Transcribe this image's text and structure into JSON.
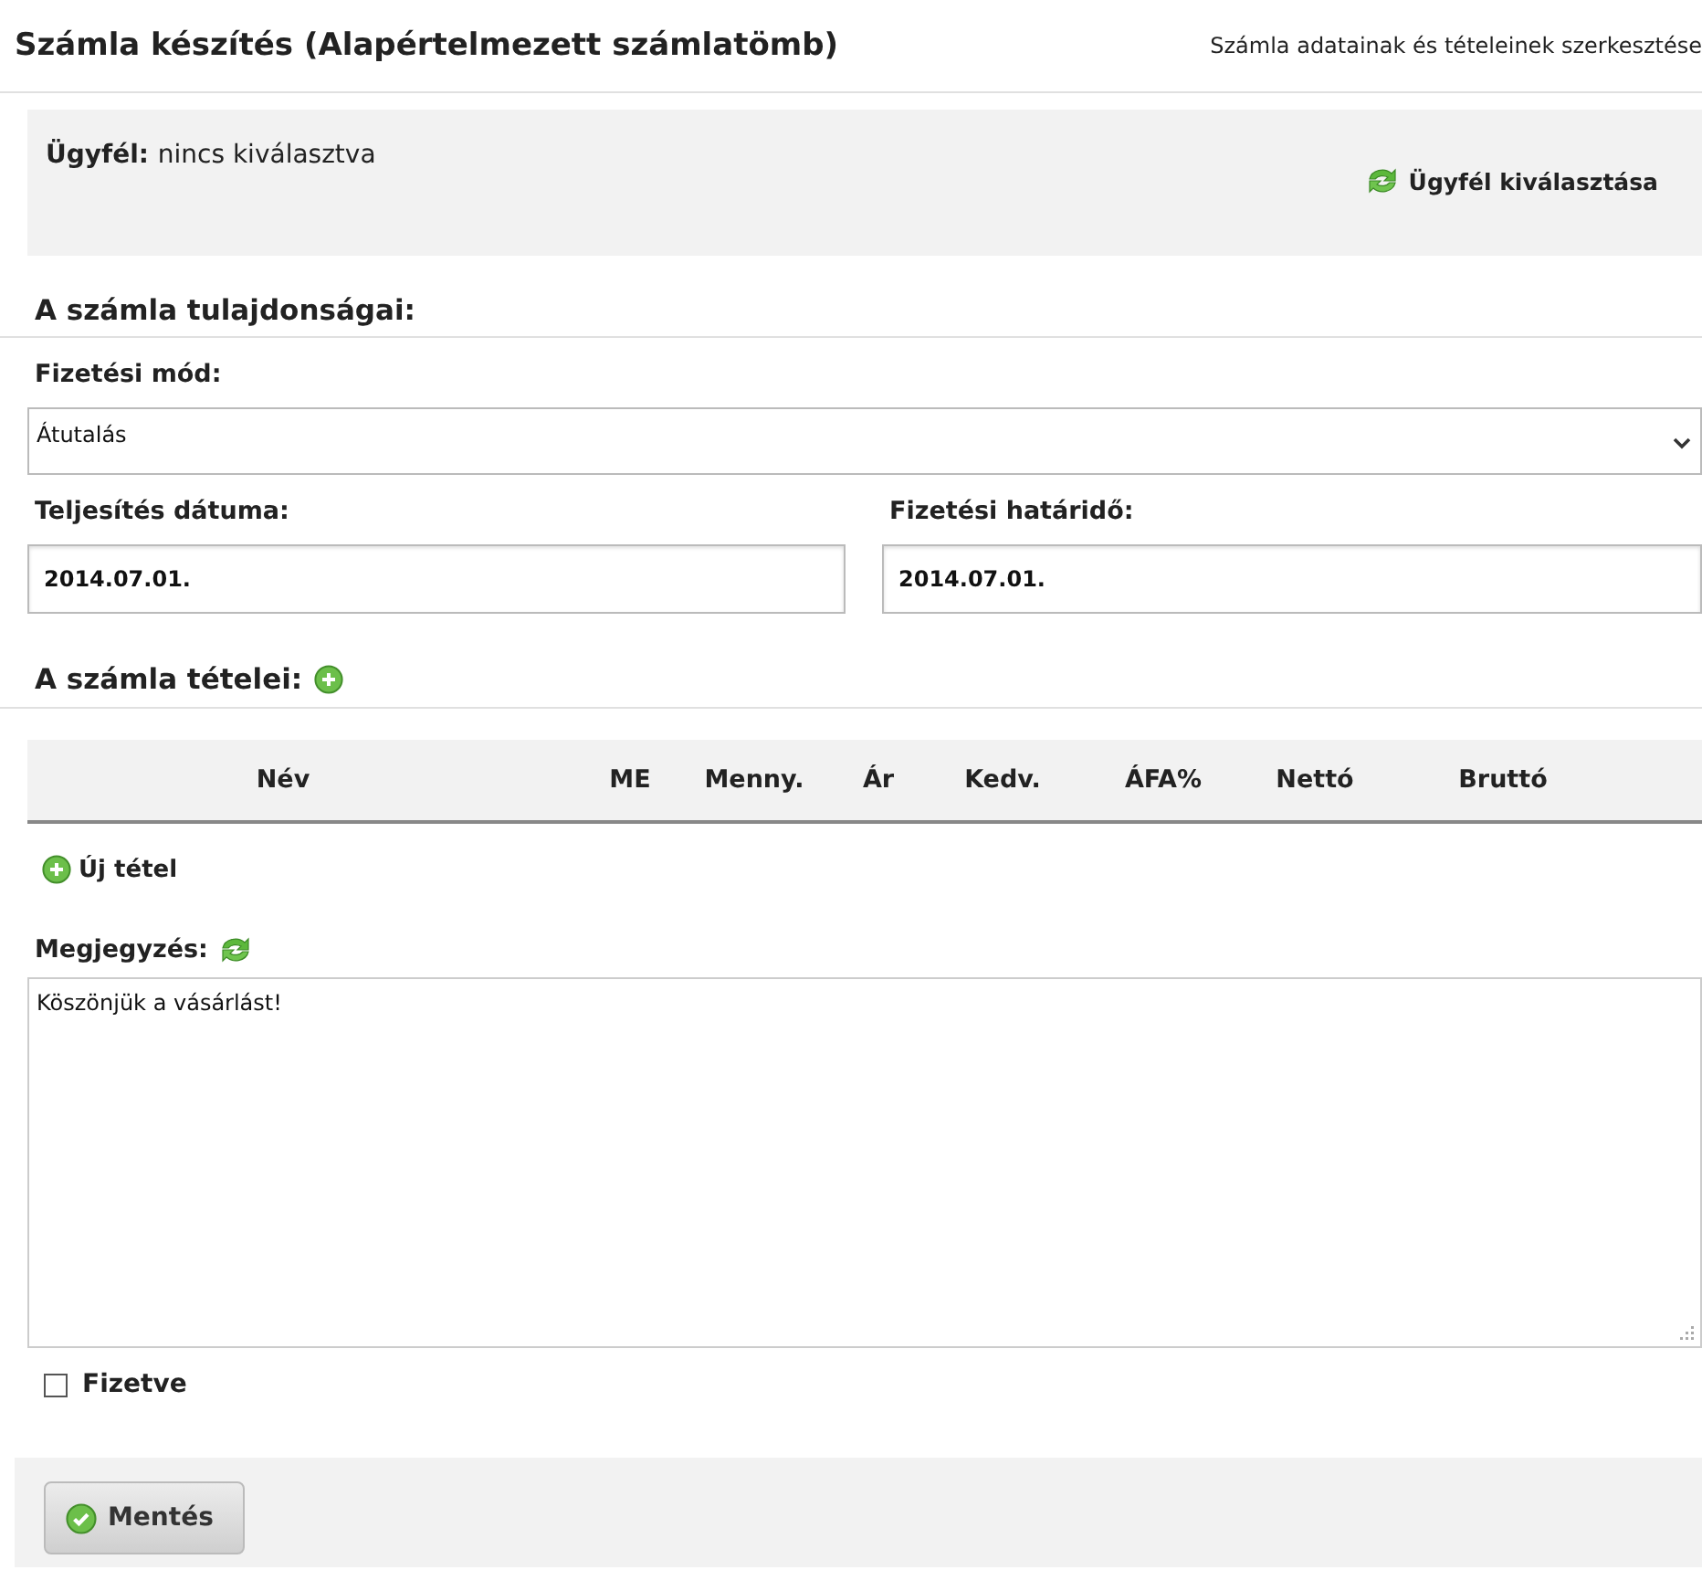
{
  "header": {
    "title": "Számla készítés (Alapértelmezett számlatömb)",
    "subtitle": "Számla adatainak és tételeinek szerkesztése"
  },
  "client": {
    "label": "Ügyfél:",
    "value": "nincs kiválasztva",
    "action": "Ügyfél kiválasztása"
  },
  "properties": {
    "heading": "A számla tulajdonságai:",
    "payment_method": {
      "label": "Fizetési mód:",
      "value": "Átutalás"
    },
    "completion_date": {
      "label": "Teljesítés dátuma:",
      "value": "2014.07.01."
    },
    "due_date": {
      "label": "Fizetési határidő:",
      "value": "2014.07.01."
    }
  },
  "items": {
    "heading": "A számla tételei:",
    "columns": [
      "Név",
      "ME",
      "Menny.",
      "Ár",
      "Kedv.",
      "ÁFA%",
      "Nettó",
      "Bruttó"
    ],
    "add_label": "Új tétel"
  },
  "note": {
    "label": "Megjegyzés:",
    "value": "Köszönjük a vásárlást!"
  },
  "paid": {
    "label": "Fizetve",
    "checked": false
  },
  "save_button": "Mentés"
}
